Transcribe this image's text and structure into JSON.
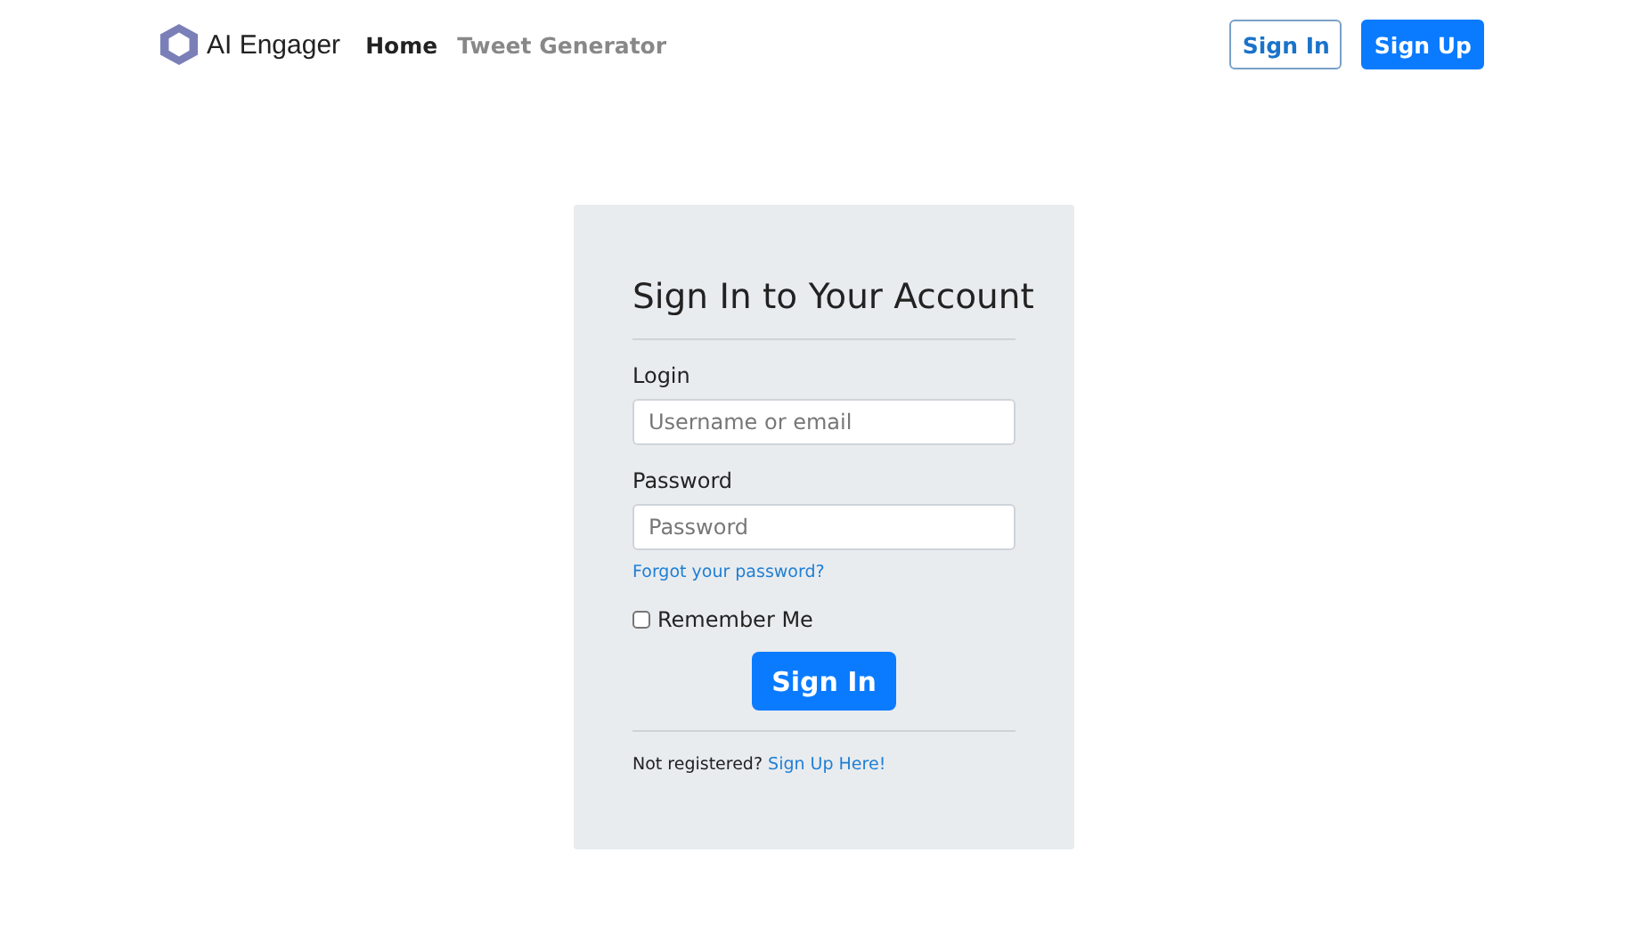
{
  "brand": {
    "name": "AI Engager"
  },
  "nav": [
    {
      "label": "Home",
      "selected": true
    },
    {
      "label": "Tweet Generator",
      "selected": false
    }
  ],
  "header_buttons": [
    {
      "label": "Sign In",
      "kind": "outline"
    },
    {
      "label": "Sign Up",
      "kind": "solid"
    }
  ],
  "form": {
    "title": "Sign In to Your Account",
    "fields": [
      {
        "label": "Login",
        "placeholder": "Username or email"
      },
      {
        "label": "Password",
        "placeholder": "Password"
      }
    ],
    "forgot_link": "Forgot your password?",
    "remember": {
      "label": "Remember Me",
      "checked": false
    },
    "submit": "Sign In",
    "footer_text": "Not registered?",
    "footer_link": "Sign Up Here!"
  }
}
